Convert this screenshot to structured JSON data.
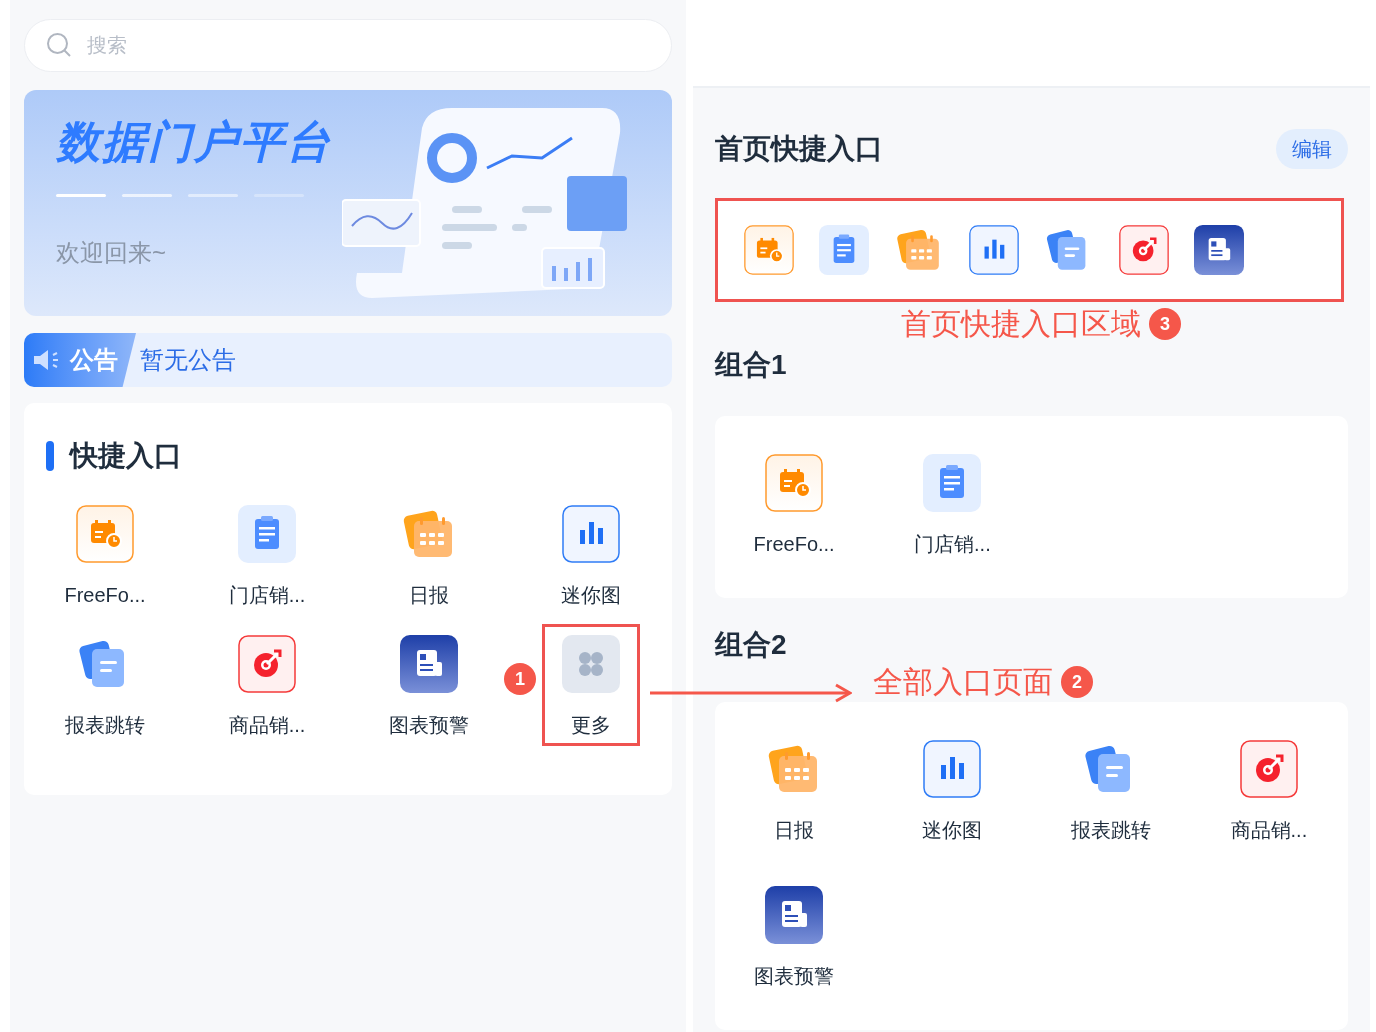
{
  "search": {
    "placeholder": "搜索"
  },
  "banner": {
    "title": "数据门户平台",
    "subtitle": "欢迎回来~"
  },
  "notice": {
    "tag": "公告",
    "text": "暂无公告"
  },
  "quick_entry": {
    "title": "快捷入口",
    "items": [
      {
        "kind": "freeform",
        "label": "FreeFo...",
        "highlighted": false
      },
      {
        "kind": "store",
        "label": "门店销...",
        "highlighted": false
      },
      {
        "kind": "daily",
        "label": "日报",
        "highlighted": false
      },
      {
        "kind": "mini",
        "label": "迷你图",
        "highlighted": false
      },
      {
        "kind": "jump",
        "label": "报表跳转",
        "highlighted": false
      },
      {
        "kind": "goods",
        "label": "商品销...",
        "highlighted": false
      },
      {
        "kind": "alert",
        "label": "图表预警",
        "highlighted": false
      },
      {
        "kind": "more",
        "label": "更多",
        "highlighted": true,
        "badge": "1"
      }
    ]
  },
  "home_shortcuts": {
    "title": "首页快捷入口",
    "edit_button": "编辑",
    "highlighted": true,
    "items": [
      {
        "kind": "freeform"
      },
      {
        "kind": "store"
      },
      {
        "kind": "daily"
      },
      {
        "kind": "mini"
      },
      {
        "kind": "jump"
      },
      {
        "kind": "goods"
      },
      {
        "kind": "alert"
      }
    ],
    "annotation": {
      "label": "首页快捷入口区域",
      "badge": "3"
    }
  },
  "groups": [
    {
      "title": "组合1",
      "items": [
        {
          "kind": "freeform",
          "label": "FreeFo..."
        },
        {
          "kind": "store",
          "label": "门店销..."
        }
      ]
    },
    {
      "title": "组合2",
      "annotation": {
        "label": "全部入口页面",
        "badge": "2"
      },
      "items": [
        {
          "kind": "daily",
          "label": "日报"
        },
        {
          "kind": "mini",
          "label": "迷你图"
        },
        {
          "kind": "jump",
          "label": "报表跳转"
        },
        {
          "kind": "goods",
          "label": "商品销..."
        },
        {
          "kind": "alert",
          "label": "图表预警"
        }
      ]
    }
  ]
}
